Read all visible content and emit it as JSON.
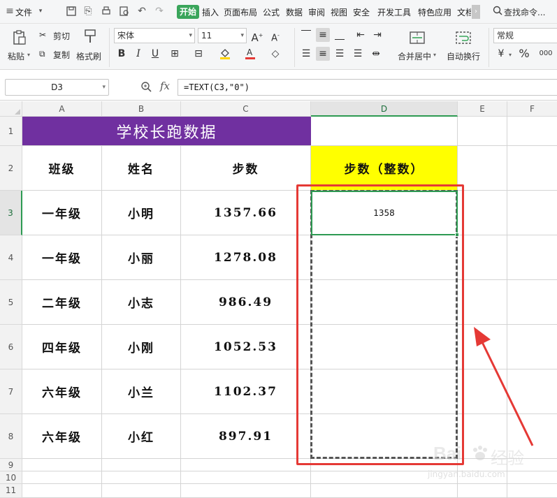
{
  "menubar": {
    "file_label": "文件",
    "tabs": [
      "开始",
      "插入",
      "页面布局",
      "公式",
      "数据",
      "审阅",
      "视图",
      "安全",
      "开发工具",
      "特色应用",
      "文档"
    ],
    "search_label": "查找命令..."
  },
  "ribbon": {
    "paste": "粘贴",
    "cut": "剪切",
    "copy": "复制",
    "format_painter": "格式刷",
    "font_name": "宋体",
    "font_size": "11",
    "bold": "B",
    "italic": "I",
    "underline": "U",
    "merge_center": "合并居中",
    "wrap_text": "自动换行",
    "number_format": "常规",
    "currency": "¥",
    "percent": "%",
    "thousands": "000"
  },
  "formula_bar": {
    "name_box": "D3",
    "fx": "fx",
    "formula": "=TEXT(C3,\"0\")"
  },
  "columns": [
    "A",
    "B",
    "C",
    "D",
    "E",
    "F"
  ],
  "rows": [
    "1",
    "2",
    "3",
    "4",
    "5",
    "6",
    "7",
    "8",
    "9",
    "10",
    "11"
  ],
  "sheet": {
    "title": "学校长跑数据",
    "headers": [
      "班级",
      "姓名",
      "步数",
      "步数（整数）"
    ],
    "data": [
      {
        "class": "一年级",
        "name": "小明",
        "steps": "1357.66",
        "integer": "1358"
      },
      {
        "class": "一年级",
        "name": "小丽",
        "steps": "1278.08",
        "integer": ""
      },
      {
        "class": "二年级",
        "name": "小志",
        "steps": "986.49",
        "integer": ""
      },
      {
        "class": "四年级",
        "name": "小刚",
        "steps": "1052.53",
        "integer": ""
      },
      {
        "class": "六年级",
        "name": "小兰",
        "steps": "1102.37",
        "integer": ""
      },
      {
        "class": "六年级",
        "name": "小红",
        "steps": "897.91",
        "integer": ""
      }
    ]
  },
  "watermark": {
    "brand": "Bai",
    "cn": "经验",
    "url": "jingyan.baidu.com"
  },
  "colors": {
    "title_bg": "#7030a0",
    "header_highlight": "#ffff00",
    "active_tab": "#3aa55b",
    "annotation": "#e53935"
  }
}
